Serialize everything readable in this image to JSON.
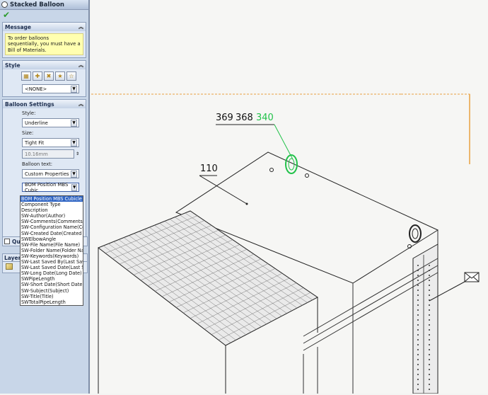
{
  "panel": {
    "title": "Stacked Balloon",
    "message": {
      "header": "Message",
      "text": "To order balloons sequentially, you must have a Bill of Materials."
    },
    "style": {
      "header": "Style",
      "value": "<NONE>"
    },
    "balloon_settings": {
      "header": "Balloon Settings",
      "style_label": "Style:",
      "style_value": "Underline",
      "size_label": "Size:",
      "size_value": "Tight Fit",
      "size_input": "10.16mm",
      "text_label": "Balloon text:",
      "text_value": "Custom Properties",
      "property_value": "BOM Position MBS Cubic"
    },
    "dropdown_items": [
      "BOM Position MBS Cubicle Vi",
      "Component Type",
      "Description",
      "SW-Author(Author)",
      "SW-Comments(Comments)",
      "SW-Configuration Name(Co",
      "SW-Created Date(Created D",
      "SWElbowAngle",
      "SW-File Name(File Name)",
      "SW-Folder Name(Folder Na",
      "SW-Keywords(Keywords)",
      "SW-Last Saved By(Last Save",
      "SW-Last Saved Date(Last S",
      "SW-Long Date(Long Date)",
      "SWPipeLength",
      "SW-Short Date(Short Date)",
      "SW-Subject(Subject)",
      "SW-Title(Title)",
      "SWTotalPipeLength"
    ],
    "quantity_label": "Qu",
    "layer_label": "Layer"
  },
  "drawing": {
    "balloons": {
      "b369": "369",
      "b368": "368",
      "b340": "340",
      "b110": "110"
    },
    "colors": {
      "highlight": "#22c24a",
      "border": "#e8a040"
    }
  }
}
